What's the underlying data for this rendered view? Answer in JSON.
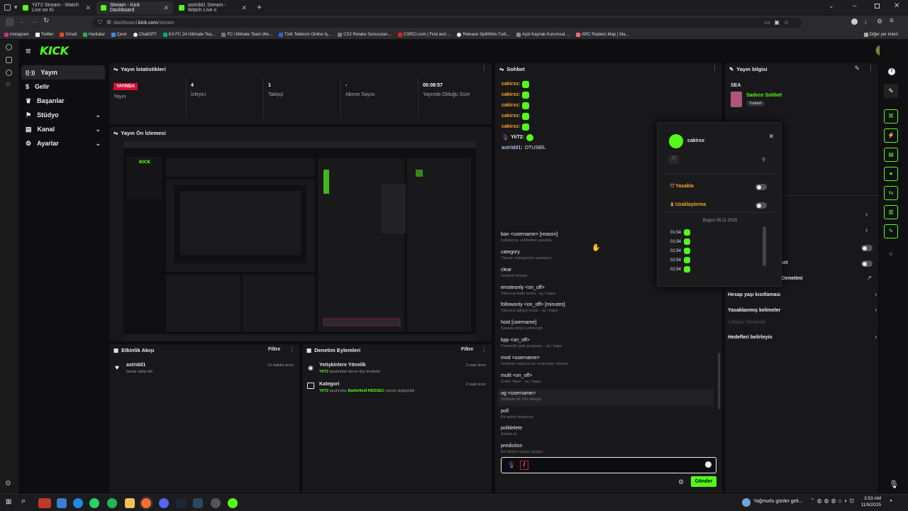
{
  "browser": {
    "tabs": [
      {
        "label": "YiiT2 Stream - Watch Live on Ki"
      },
      {
        "label": "Stream - Kick Dashboard"
      },
      {
        "label": "astridd1 Stream - Watch Live o"
      }
    ],
    "url_prefix": "dashboard.",
    "url_domain": "kick.com",
    "url_path": "/stream",
    "bookmarks": [
      "Instagram",
      "Twitter",
      "Gmail",
      "Haritalar",
      "Çevir",
      "ChatGPT",
      "EA FC 24 Ultimate Tea...",
      "FC Ultimate Team We...",
      "Türk Telekom Online İş...",
      "CS2 Retake Sunucuları...",
      "CSRCI.com | Find and ...",
      "Release SplitWire-Turk...",
      "Açık Kaynak Kurumsal ...",
      "ARC Raiders Map | Ma..."
    ],
    "other_bookmarks": "Diğer yer imleri"
  },
  "app": {
    "logo": "KICK",
    "nav": [
      {
        "label": "Yayın",
        "icon": "broadcast-icon",
        "active": true
      },
      {
        "label": "Gelir",
        "icon": "dollar-icon"
      },
      {
        "label": "Başarılar",
        "icon": "trophy-icon"
      },
      {
        "label": "Stüdyo",
        "icon": "studio-icon",
        "expand": true
      },
      {
        "label": "Kanal",
        "icon": "channel-icon",
        "expand": true
      },
      {
        "label": "Ayarlar",
        "icon": "settings-icon",
        "expand": true
      }
    ]
  },
  "stats": {
    "title": "Yayın İstatistikleri",
    "live_badge": "YAYINDA",
    "items": [
      {
        "value": "",
        "label": "Yayın"
      },
      {
        "value": "4",
        "label": "İzleyici"
      },
      {
        "value": "1",
        "label": "Takipçi"
      },
      {
        "value": "-",
        "label": "Abone Sayısı"
      },
      {
        "value": "00:08:57",
        "label": "Yayında Olduğu Süre"
      }
    ]
  },
  "preview": {
    "title": "Yayın Ön İzlemesi"
  },
  "activity": {
    "title": "Etkinlik Akışı",
    "filter": "Filtre",
    "items": [
      {
        "user": "astridd1",
        "text": "kanalı takip etti",
        "time": "12 dakika önce"
      }
    ]
  },
  "moderation": {
    "title": "Denetim Eylemleri",
    "filter": "Filtre",
    "items": [
      {
        "title": "Yetişkinlere Yönelik",
        "user": "YiiT2",
        "text": "tarafından devre dışı bırakıldı",
        "time": "2 saat önce"
      },
      {
        "title": "Kategori",
        "user": "YiiT2",
        "text_a": "tarafından",
        "highlight": "Battlefield REDSEC",
        "text_b": "olarak değiştirildi",
        "time": "2 saat önce"
      }
    ]
  },
  "chat": {
    "title": "Sohbet",
    "messages": [
      {
        "user": "cakirxx:"
      },
      {
        "user": "cakirxx:"
      },
      {
        "user": "cakirxx:"
      },
      {
        "user": "cakirxx:"
      },
      {
        "user": "cakirxx:"
      },
      {
        "user": "YiiT2:"
      }
    ],
    "last_message_user": "astridd1:",
    "last_message_text": "OTUSBİL",
    "commands": [
      {
        "name": "ban <username> [reason]",
        "desc": "Kullanıcıyı sohbetten yasakla"
      },
      {
        "name": "category",
        "desc": "Yayının kategorisini ayarlayın"
      },
      {
        "name": "clear",
        "desc": "Sohbeti temizle"
      },
      {
        "name": "emoteonly <on_off>",
        "desc": "Yalnızca ifade modu - aç / kapa"
      },
      {
        "name": "followonly <on_off> [minutes]",
        "desc": "Yalnızca takipçi modu - aç / kapa"
      },
      {
        "name": "host [username]",
        "desc": "Kanala izleyici yönlendir"
      },
      {
        "name": "kpp <on_off>",
        "desc": "Partnerlik gelir programı - aç / kapa"
      },
      {
        "name": "mod <username>",
        "desc": "Sohbete odasına bir moderatör ekleyin"
      },
      {
        "name": "multi <on_off>",
        "desc": "Çoklu Yayın - aç / kapa"
      },
      {
        "name": "og <username>",
        "desc": "Sohbete bir OG ekleyin"
      },
      {
        "name": "poll",
        "desc": "Bir anket oluşturun"
      },
      {
        "name": "polldelete",
        "desc": "Anketi sil"
      },
      {
        "name": "prediction",
        "desc": "Bir tahmin oyunu oluştur"
      }
    ],
    "input_value": "/",
    "send_label": "Gönder"
  },
  "popup": {
    "username": "cakirxx",
    "ban_label": "Yasakla",
    "timeout_label": "Uzaklaştırma",
    "date_label": "Bugün 09.11.2025",
    "times": [
      "01:54",
      "01:54",
      "01:54",
      "01:54",
      "01:54"
    ]
  },
  "info": {
    "title": "Yayın bilgisi",
    "stream_title": "SEA",
    "chat_mode": "Sadece Sohbet",
    "language": "Turkish",
    "partial_a": "et",
    "partial_b": "bet",
    "partial_c": "Denetimi",
    "links": [
      "Hesap yaşı kısıtlaması",
      "Yasaklanmış kelimeler"
    ],
    "muted_label": "İzleyici Yönlendir",
    "goals_label": "Hedefleri belirleyin"
  },
  "taskbar": {
    "weather": "Yağmurlu günler geli...",
    "time": "3:53 AM",
    "date": "11/9/2025"
  },
  "colors": {
    "accent": "#53fc18",
    "live": "#d40f3a",
    "username": "#f5a623"
  }
}
